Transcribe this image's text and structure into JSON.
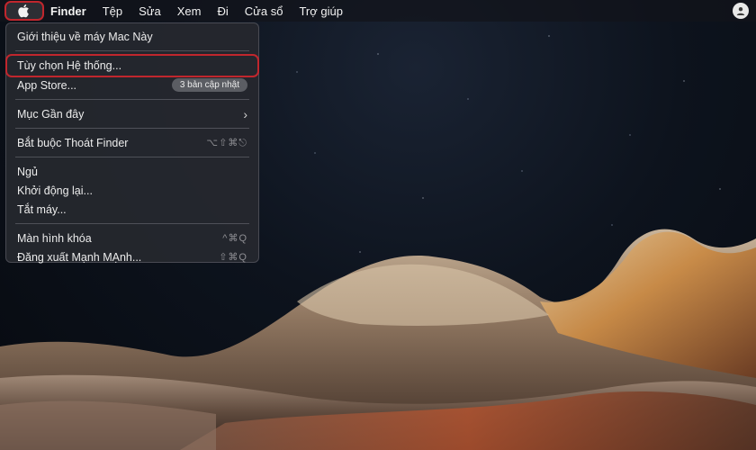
{
  "menubar": {
    "apple_icon": "apple-logo-icon",
    "app_name": "Finder",
    "items": [
      "Tệp",
      "Sửa",
      "Xem",
      "Đi",
      "Cửa sổ",
      "Trợ giúp"
    ],
    "right_icon": "user-account-icon"
  },
  "apple_menu": {
    "about": "Giới thiệu về máy Mac Này",
    "system_settings": "Tùy chọn Hệ thống...",
    "app_store": "App Store...",
    "app_store_badge": "3 bản cập nhật",
    "recent_items": "Mục Gần đây",
    "force_quit": "Bắt buộc Thoát Finder",
    "force_quit_shortcut": "⌥⇧⌘⎋",
    "sleep": "Ngủ",
    "restart": "Khởi động lại...",
    "shutdown": "Tắt máy...",
    "lock_screen": "Màn hình khóa",
    "lock_screen_shortcut": "^⌘Q",
    "logout": "Đăng xuất Mạnh MẠnh...",
    "logout_shortcut": "⇧⌘Q"
  },
  "colors": {
    "highlight_annotation": "#c0262d",
    "menu_background": "#26282e"
  }
}
